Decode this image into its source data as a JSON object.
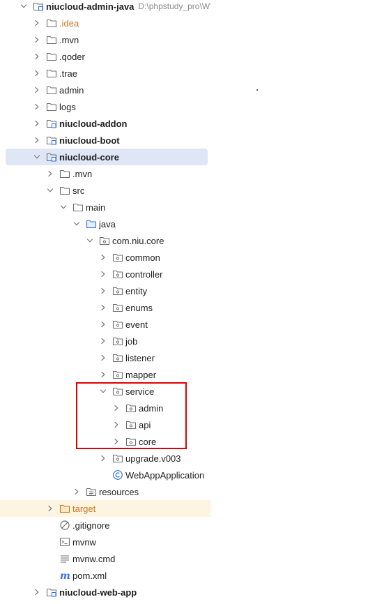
{
  "project": {
    "root_label": "niucloud-admin-java",
    "root_path": "D:\\phpstudy_pro\\WWW"
  },
  "tree": [
    {
      "label": "niucloud-admin-java",
      "depth": 0,
      "icon": "module-folder-icon",
      "chevron": "down",
      "bold": true,
      "hint": "D:\\phpstudy_pro\\WWW"
    },
    {
      "label": ".idea",
      "depth": 1,
      "icon": "folder-icon",
      "chevron": "right",
      "color": "orange"
    },
    {
      "label": ".mvn",
      "depth": 1,
      "icon": "folder-icon",
      "chevron": "right"
    },
    {
      "label": ".qoder",
      "depth": 1,
      "icon": "folder-icon",
      "chevron": "right"
    },
    {
      "label": ".trae",
      "depth": 1,
      "icon": "folder-icon",
      "chevron": "right"
    },
    {
      "label": "admin",
      "depth": 1,
      "icon": "folder-icon",
      "chevron": "right"
    },
    {
      "label": "logs",
      "depth": 1,
      "icon": "folder-icon",
      "chevron": "right"
    },
    {
      "label": "niucloud-addon",
      "depth": 1,
      "icon": "module-folder-icon",
      "chevron": "right",
      "bold": true
    },
    {
      "label": "niucloud-boot",
      "depth": 1,
      "icon": "module-folder-icon",
      "chevron": "right",
      "bold": true
    },
    {
      "label": "niucloud-core",
      "depth": 1,
      "icon": "module-folder-icon",
      "chevron": "down",
      "bold": true,
      "selected": true
    },
    {
      "label": ".mvn",
      "depth": 2,
      "icon": "folder-icon",
      "chevron": "right"
    },
    {
      "label": "src",
      "depth": 2,
      "icon": "folder-icon",
      "chevron": "down"
    },
    {
      "label": "main",
      "depth": 3,
      "icon": "folder-icon",
      "chevron": "down"
    },
    {
      "label": "java",
      "depth": 4,
      "icon": "source-folder-icon",
      "chevron": "down"
    },
    {
      "label": "com.niu.core",
      "depth": 5,
      "icon": "package-icon",
      "chevron": "down"
    },
    {
      "label": "common",
      "depth": 6,
      "icon": "package-icon",
      "chevron": "right"
    },
    {
      "label": "controller",
      "depth": 6,
      "icon": "package-icon",
      "chevron": "right"
    },
    {
      "label": "entity",
      "depth": 6,
      "icon": "package-icon",
      "chevron": "right"
    },
    {
      "label": "enums",
      "depth": 6,
      "icon": "package-icon",
      "chevron": "right"
    },
    {
      "label": "event",
      "depth": 6,
      "icon": "package-icon",
      "chevron": "right"
    },
    {
      "label": "job",
      "depth": 6,
      "icon": "package-icon",
      "chevron": "right"
    },
    {
      "label": "listener",
      "depth": 6,
      "icon": "package-icon",
      "chevron": "right"
    },
    {
      "label": "mapper",
      "depth": 6,
      "icon": "package-icon",
      "chevron": "right"
    },
    {
      "label": "service",
      "depth": 6,
      "icon": "package-icon",
      "chevron": "down"
    },
    {
      "label": "admin",
      "depth": 7,
      "icon": "package-icon",
      "chevron": "right"
    },
    {
      "label": "api",
      "depth": 7,
      "icon": "package-icon",
      "chevron": "right"
    },
    {
      "label": "core",
      "depth": 7,
      "icon": "package-icon",
      "chevron": "right"
    },
    {
      "label": "upgrade.v003",
      "depth": 6,
      "icon": "package-icon",
      "chevron": "right"
    },
    {
      "label": "WebAppApplication",
      "depth": 6,
      "icon": "java-class-icon",
      "chevron": "none"
    },
    {
      "label": "resources",
      "depth": 4,
      "icon": "resources-folder-icon",
      "chevron": "right"
    },
    {
      "label": "target",
      "depth": 2,
      "icon": "excluded-folder-icon",
      "chevron": "right",
      "color": "orange",
      "excluded": true
    },
    {
      "label": ".gitignore",
      "depth": 2,
      "icon": "gitignore-icon",
      "chevron": "none"
    },
    {
      "label": "mvnw",
      "depth": 2,
      "icon": "terminal-file-icon",
      "chevron": "none"
    },
    {
      "label": "mvnw.cmd",
      "depth": 2,
      "icon": "text-file-icon",
      "chevron": "none"
    },
    {
      "label": "pom.xml",
      "depth": 2,
      "icon": "maven-icon",
      "chevron": "none"
    },
    {
      "label": "niucloud-web-app",
      "depth": 1,
      "icon": "module-folder-icon",
      "chevron": "right",
      "bold": true
    }
  ],
  "annotation": {
    "highlight_color": "#e00000"
  },
  "colors": {
    "selected_row": "#dfe6f5",
    "excluded_row": "#fdf5e2",
    "orange_text": "#c7771e",
    "folder_stroke": "#6e6e6e",
    "package_stroke": "#6e6e6e",
    "java_class": "#3574f0",
    "maven_blue": "#3574f0"
  }
}
